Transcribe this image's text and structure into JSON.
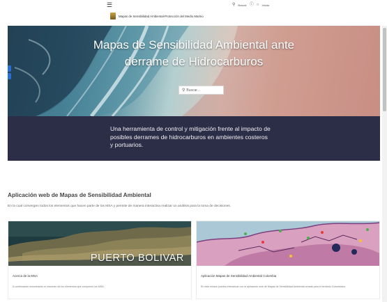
{
  "header": {
    "menu_icon": "hamburger-icon",
    "search_icon": "search-icon",
    "search_label": "Buscar",
    "help_icon": "help-icon",
    "signin_label": "Iniciar",
    "brand_title": "Mapas de Sensibilidad Ambiental-Protección del Medio Marino"
  },
  "hero": {
    "title_line1": "Mapas de Sensibilidad Ambiental ante",
    "title_line2": "derrame de Hidrocarburos",
    "search_placeholder": "Buscar..."
  },
  "band": {
    "text": "Una herramienta de control y mitigación frente al impacto de posibles derrames de hidrocarburos en ambientes costeros y portuarios."
  },
  "section": {
    "title": "Aplicación web de Mapas de Sensibilidad Ambiental",
    "subtitle": "En la cual convergen todos los elementos que hacen parte de los MSA y permite de manera interactiva realizar un análisis para la toma de decisiones."
  },
  "cards": [
    {
      "image_text": "PUERTO BOLIVAR",
      "title": "Acerca de la MSA",
      "description": "A continuación encontrarás un resumen de los elementos que componen los MSA."
    },
    {
      "title": "Aplicación Mapas de Sensibilidad Ambiental Colombia",
      "description": "En este enlace puedes interactuar con la aplicación web de Mapas de Sensibilidad Ambiental creada para el territorio Colombiano."
    }
  ],
  "colors": {
    "band_bg": "#2c2d47",
    "accent_blue": "#2a6fd6"
  }
}
